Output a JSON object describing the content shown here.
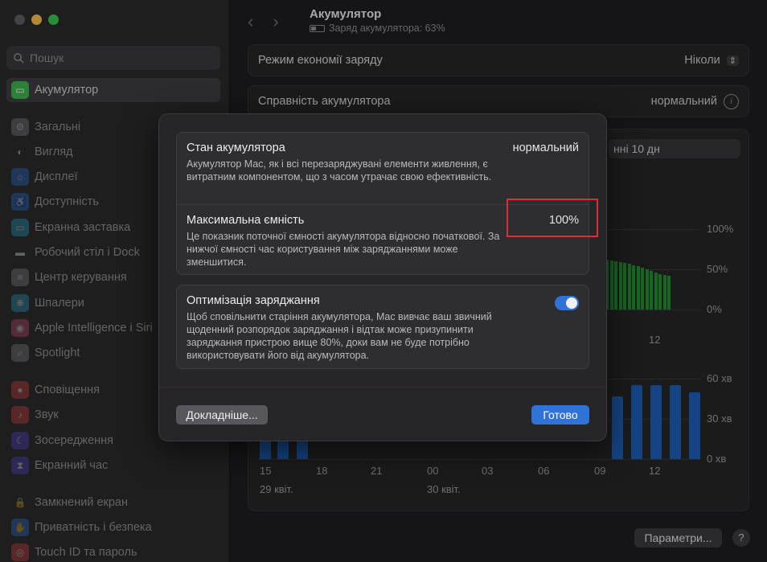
{
  "sidebar": {
    "search_placeholder": "Пошук",
    "selected": {
      "label": "Акумулятор",
      "icon": "battery-icon",
      "color": "#3fb24e"
    },
    "items": [
      {
        "label": "Загальні",
        "icon": "gear-icon",
        "color": "#8e8e93"
      },
      {
        "label": "Вигляд",
        "icon": "appearance-icon",
        "color": "#2c2c2e"
      },
      {
        "label": "Дисплеї",
        "icon": "display-icon",
        "color": "#2f7be0"
      },
      {
        "label": "Доступність",
        "icon": "accessibility-icon",
        "color": "#2f7be0"
      },
      {
        "label": "Екранна заставка",
        "icon": "screensaver-icon",
        "color": "#37a4c9"
      },
      {
        "label": "Робочий стіл і Dock",
        "icon": "dock-icon",
        "color": "#2c2c2e"
      },
      {
        "label": "Центр керування",
        "icon": "control-center-icon",
        "color": "#8e8e93"
      },
      {
        "label": "Шпалери",
        "icon": "wallpaper-icon",
        "color": "#37a4c9"
      },
      {
        "label": "Apple Intelligence і Siri",
        "icon": "siri-icon",
        "color": "#d4507a"
      },
      {
        "label": "Spotlight",
        "icon": "spotlight-icon",
        "color": "#8e8e93"
      },
      {
        "label": "Сповіщення",
        "icon": "notifications-icon",
        "color": "#e04848"
      },
      {
        "label": "Звук",
        "icon": "sound-icon",
        "color": "#e04848"
      },
      {
        "label": "Зосередження",
        "icon": "focus-icon",
        "color": "#5b4bd6"
      },
      {
        "label": "Екранний час",
        "icon": "screen-time-icon",
        "color": "#5b4bd6"
      },
      {
        "label": "Замкнений екран",
        "icon": "lock-screen-icon",
        "color": "#2c2c2e"
      },
      {
        "label": "Приватність і безпека",
        "icon": "privacy-icon",
        "color": "#2f7be0"
      },
      {
        "label": "Touch ID та пароль",
        "icon": "touch-id-icon",
        "color": "#e04848"
      }
    ]
  },
  "header": {
    "title": "Акумулятор",
    "subtitle": "Заряд акумулятора: 63%"
  },
  "settings": {
    "low_power_label": "Режим економії заряду",
    "low_power_value": "Ніколи",
    "health_label": "Справність акумулятора",
    "health_value": "нормальний"
  },
  "chart": {
    "range_label": "нні 10 дн",
    "level_ticks": [
      "100%",
      "50%",
      "0%"
    ],
    "usage_ticks": [
      "60 хв",
      "30 хв",
      "0 хв"
    ],
    "x_ticks": [
      "15",
      "18",
      "21",
      "00",
      "03",
      "06",
      "09",
      "12"
    ],
    "upper_x_tick": "12",
    "date_labels": [
      "29 квіт.",
      "30 квіт."
    ]
  },
  "chart_data": {
    "type": "bar",
    "series": [
      {
        "values": [
          62,
          61,
          60,
          59,
          58,
          57,
          55,
          54,
          52,
          50,
          48,
          46,
          44,
          43,
          42
        ]
      },
      {
        "values": [
          17,
          17,
          17,
          47,
          55,
          55,
          55,
          50
        ]
      }
    ],
    "ylim_level": [
      0,
      100
    ],
    "ylim_usage": [
      0,
      60
    ]
  },
  "footer": {
    "params_label": "Параметри...",
    "help_label": "?"
  },
  "modal": {
    "condition_title": "Стан акумулятора",
    "condition_value": "нормальний",
    "condition_desc": "Акумулятор Mac, як і всі перезаряджувані елементи живлення, є витратним компонентом, що з часом утрачає свою ефективність.",
    "capacity_title": "Максимальна ємність",
    "capacity_value": "100%",
    "capacity_desc": "Це показник поточної ємності акумулятора відносно початкової. За нижчої ємності час користування між заряджаннями може зменшитися.",
    "optimize_title": "Оптимізація заряджання",
    "optimize_desc": "Щоб сповільнити старіння акумулятора, Mac вивчає ваш звичний щоденний розпорядок заряджання і відтак може призупинити заряджання пристрою вище 80%, доки вам не буде потрібно використовувати його від акумулятора.",
    "optimize_enabled": true,
    "more_button": "Докладніше...",
    "done_button": "Готово"
  }
}
